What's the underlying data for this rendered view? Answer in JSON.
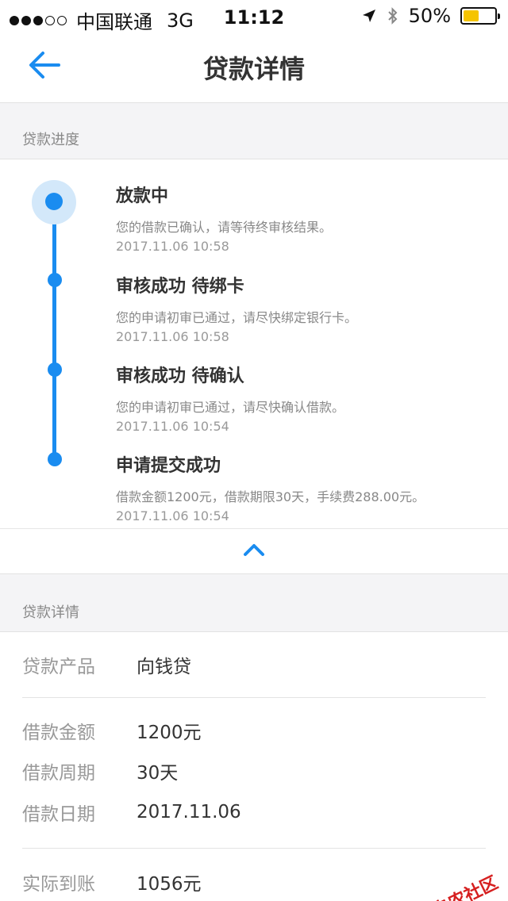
{
  "status_bar": {
    "carrier": "中国联通",
    "network": "3G",
    "time": "11:12",
    "battery": "50%",
    "battery_level": 0.5,
    "signal_strength": 3,
    "signal_total": 5
  },
  "nav": {
    "title": "贷款详情",
    "back_icon": "arrow-left-icon"
  },
  "progress_section": {
    "title": "贷款进度",
    "steps": [
      {
        "title": "放款中",
        "desc": "您的借款已确认，请等待终审核结果。",
        "time": "2017.11.06 10:58"
      },
      {
        "title": "审核成功 待绑卡",
        "desc": "您的申请初审已通过，请尽快绑定银行卡。",
        "time": "2017.11.06 10:58"
      },
      {
        "title": "审核成功 待确认",
        "desc": "您的申请初审已通过，请尽快确认借款。",
        "time": "2017.11.06 10:54"
      },
      {
        "title": "申请提交成功",
        "desc": "借款金额1200元，借款期限30天，手续费288.00元。",
        "time": "2017.11.06 10:54"
      }
    ],
    "collapse_icon": "chevron-up-icon"
  },
  "details_section": {
    "title": "贷款详情",
    "rows": [
      {
        "label": "贷款产品",
        "value": "向钱贷"
      },
      {
        "label": "借款金额",
        "value": "1200元"
      },
      {
        "label": "借款周期",
        "value": "30天"
      },
      {
        "label": "借款日期",
        "value": "2017.11.06"
      },
      {
        "label": "实际到账",
        "value": "1056元"
      }
    ]
  },
  "watermark": {
    "text": "卡农社区"
  },
  "colors": {
    "accent": "#1a8cf0",
    "halo": "#d3e8fa",
    "background": "#f4f4f6",
    "watermark": "#d62020"
  }
}
